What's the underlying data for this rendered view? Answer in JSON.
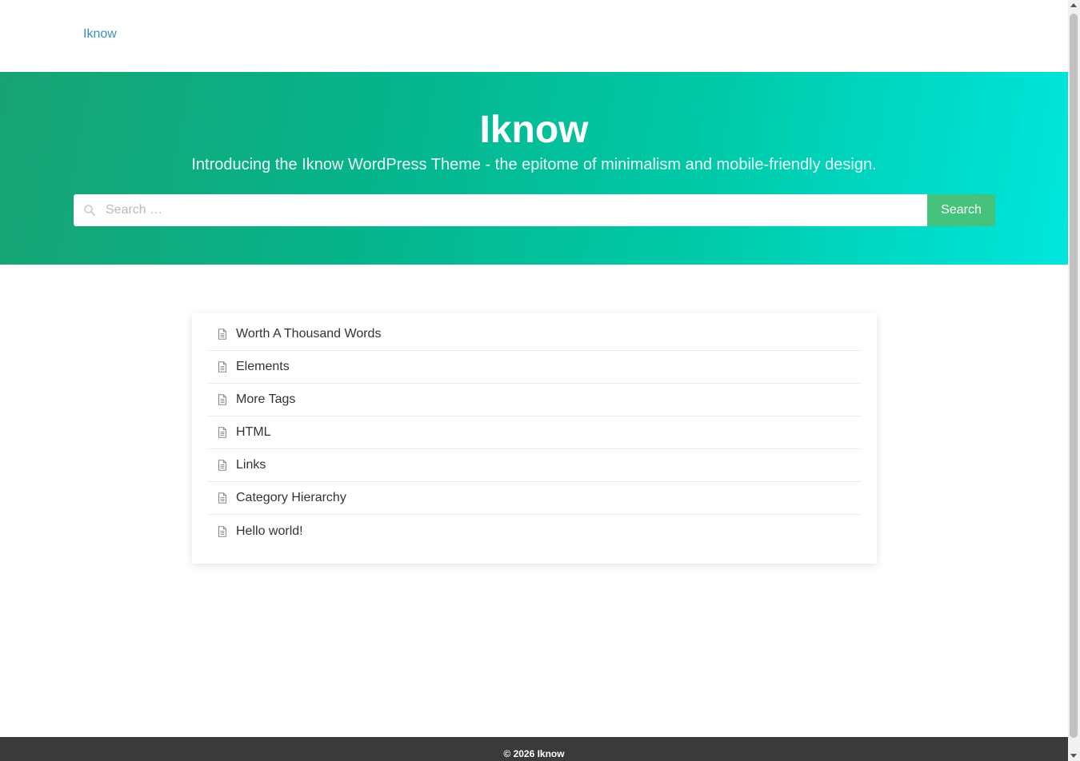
{
  "header": {
    "brand": "Iknow"
  },
  "hero": {
    "title": "Iknow",
    "subtitle": "Introducing the Iknow WordPress Theme - the epitome of minimalism and mobile-friendly design.",
    "gradient_start": "#17a373",
    "gradient_end": "#00e6dd"
  },
  "search": {
    "placeholder": "Search …",
    "value": "",
    "button_label": "Search",
    "button_color": "#45c27c",
    "icon": "search-icon"
  },
  "posts": {
    "icon": "document-icon",
    "items": [
      {
        "title": "Worth A Thousand Words"
      },
      {
        "title": "Elements"
      },
      {
        "title": "More Tags"
      },
      {
        "title": "HTML"
      },
      {
        "title": "Links"
      },
      {
        "title": "Category Hierarchy"
      },
      {
        "title": "Hello world!"
      }
    ]
  },
  "footer": {
    "copyright": "© 2026 Iknow"
  },
  "colors": {
    "link": "#3a8fc0",
    "footer_bg": "#3a3a3a"
  }
}
